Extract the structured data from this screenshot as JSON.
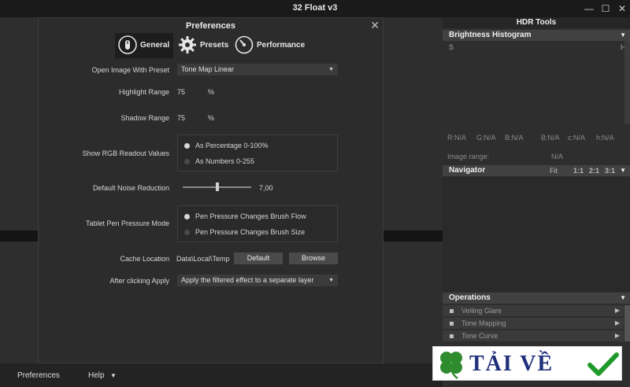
{
  "app": {
    "title": "32 Float v3",
    "controls": {
      "minimize": "—",
      "maximize": "☐",
      "close": "✕"
    }
  },
  "dialog": {
    "title": "Preferences",
    "close": "✕",
    "tabs": [
      {
        "label": "General",
        "icon": "pen-icon",
        "active": true
      },
      {
        "label": "Presets",
        "icon": "gear-icon",
        "active": false
      },
      {
        "label": "Performance",
        "icon": "gauge-icon",
        "active": false
      }
    ],
    "open_image_preset": {
      "label": "Open Image With Preset",
      "value": "Tone Map Linear"
    },
    "highlight_range": {
      "label": "Highlight Range",
      "value": "75",
      "unit": "%"
    },
    "shadow_range": {
      "label": "Shadow Range",
      "value": "75",
      "unit": "%"
    },
    "rgb_readout": {
      "label": "Show RGB Readout Values",
      "options": [
        "As Percentage 0-100%",
        "As Numbers 0-255"
      ],
      "selected": 0
    },
    "noise_reduction": {
      "label": "Default Noise Reduction",
      "value": "7,00",
      "level": 0.5
    },
    "tablet_pen": {
      "label": "Tablet Pen Pressure Mode",
      "options": [
        "Pen Pressure Changes Brush Flow",
        "Pen Pressure Changes Brush Size"
      ],
      "selected": 0
    },
    "cache_location": {
      "label": "Cache Location",
      "value": "Data\\Local\\Temp",
      "default_btn": "Default",
      "browse_btn": "Browse"
    },
    "after_clicking_apply": {
      "label": "After clicking Apply",
      "value": "Apply the filtered effect to a separate layer"
    }
  },
  "bottombar": {
    "preferences": "Preferences",
    "help": "Help",
    "help_caret": "▼"
  },
  "hdr_tools": {
    "title": "HDR Tools",
    "histogram": {
      "title": "Brightness Histogram",
      "left_marker": "S",
      "right_marker": "H",
      "readouts": [
        "R:N/A",
        "G:N/A",
        "B:N/A",
        "B:N/A",
        "c:N/A",
        "h:N/A"
      ],
      "image_range_label": "Image range:",
      "image_range_value": "N/A"
    },
    "navigator": {
      "title": "Navigator",
      "zoom": [
        "Fit",
        "1:1",
        "2:1",
        "3:1"
      ]
    },
    "operations": {
      "title": "Operations",
      "items": [
        "Veiling Glare",
        "Tone Mapping",
        "Tone Curve"
      ]
    }
  },
  "watermark": {
    "text": "TẢI VỀ"
  },
  "colors": {
    "panel_header": "#414141",
    "dialog_bg": "#2c2c2c",
    "watermark_blue": "#1f2f7a",
    "clover_green": "#2e8b2e",
    "check_green": "#1f9a2a"
  }
}
